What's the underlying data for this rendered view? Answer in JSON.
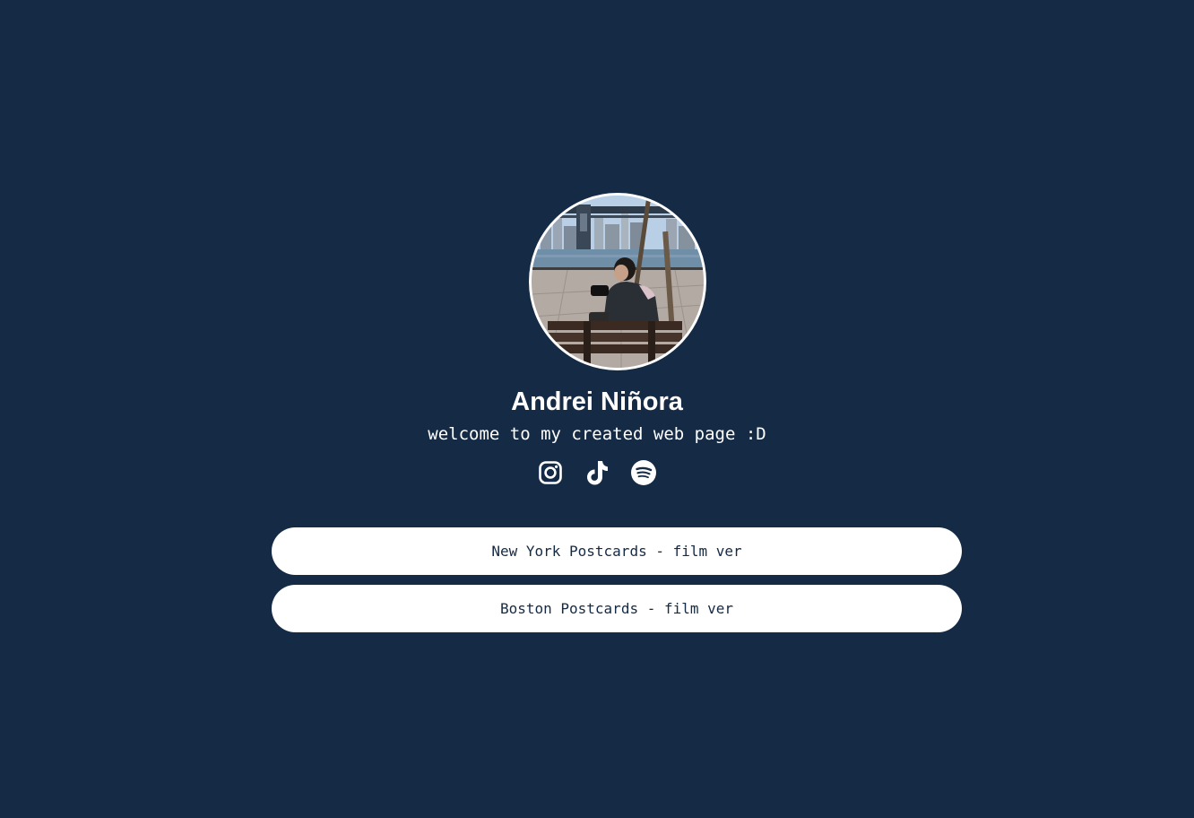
{
  "profile": {
    "name": "Andrei Niñora",
    "tagline": "welcome to my created web page :D",
    "avatar_icon": "profile-photo"
  },
  "socials": [
    {
      "icon": "instagram-icon"
    },
    {
      "icon": "tiktok-icon"
    },
    {
      "icon": "spotify-icon"
    }
  ],
  "links": [
    {
      "label": "New York Postcards - film ver"
    },
    {
      "label": "Boston Postcards - film ver"
    }
  ],
  "colors": {
    "background": "#142a45",
    "button_bg": "#ffffff",
    "button_text": "#142a45",
    "text": "#ffffff"
  }
}
